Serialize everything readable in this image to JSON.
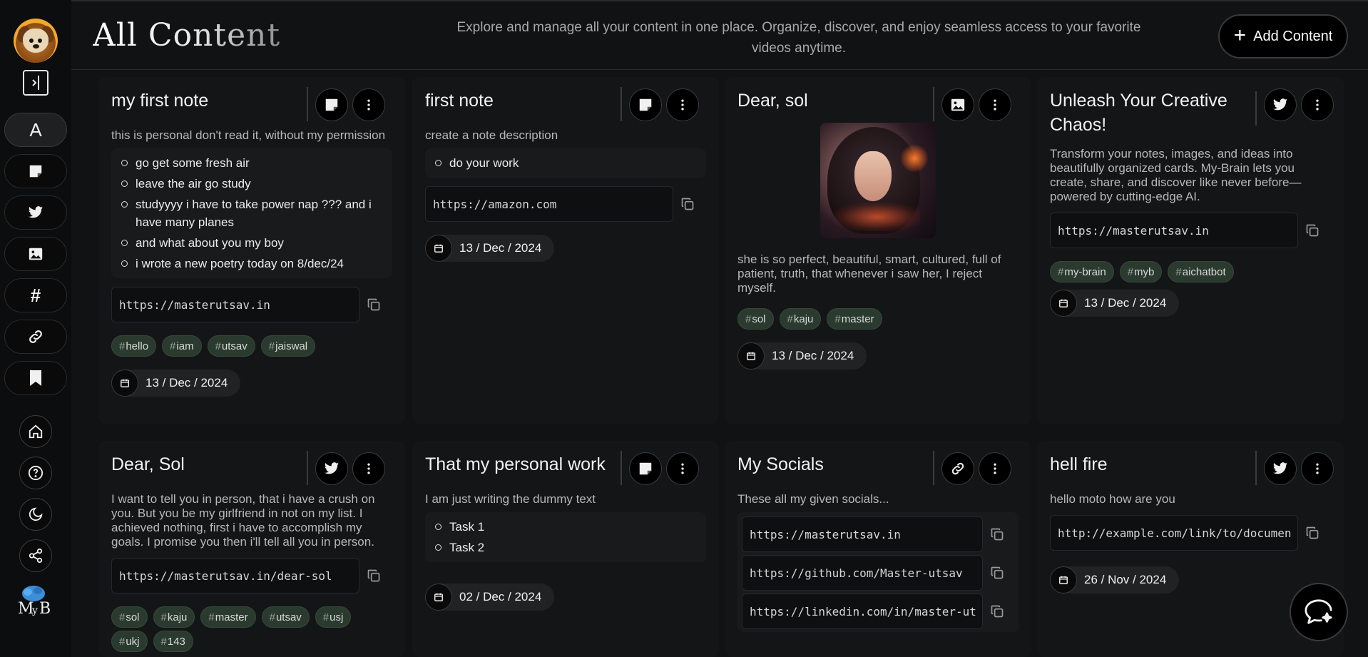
{
  "header": {
    "title": "All Content",
    "subtitle": "Explore and manage all your content in one place. Organize, discover, and enjoy seamless access to your favorite videos anytime.",
    "add_button": "Add Content"
  },
  "sidebar": {
    "nav_items": [
      {
        "name": "all",
        "label": "A"
      },
      {
        "name": "notes",
        "icon": "note-icon"
      },
      {
        "name": "tweets",
        "icon": "twitter-icon"
      },
      {
        "name": "images",
        "icon": "image-icon"
      },
      {
        "name": "tags",
        "label": "#"
      },
      {
        "name": "links",
        "icon": "link-icon"
      },
      {
        "name": "bookmarks",
        "icon": "bookmark-icon"
      }
    ],
    "round_items": [
      "home-icon",
      "help-icon",
      "moon-icon",
      "share-icon"
    ],
    "brand": "MyB"
  },
  "cards": [
    {
      "title": "my first note",
      "type_icon": "note-icon",
      "description": "this is personal don't read it, without my permission",
      "tasks": [
        "go get some fresh air",
        "leave the air go study",
        "studyyyy i have to take power nap ??? and i have many planes",
        "and what about you my boy",
        "i wrote a new poetry today on 8/dec/24"
      ],
      "links": [
        "https://masterutsav.in"
      ],
      "tags": [
        "hello",
        "iam",
        "utsav",
        "jaiswal"
      ],
      "date": "13 / Dec / 2024"
    },
    {
      "title": "first note",
      "type_icon": "note-icon",
      "description": "create a note description",
      "tasks": [
        "do your work"
      ],
      "links": [
        "https://amazon.com"
      ],
      "tags": [],
      "date": "13 / Dec / 2024"
    },
    {
      "title": "Dear, sol",
      "type_icon": "image-icon",
      "description": "she is so perfect, beautiful, smart, cultured, full of patient, truth, that whenever i saw her, I reject myself.",
      "tags": [
        "sol",
        "kaju",
        "master"
      ],
      "date": "13 / Dec / 2024"
    },
    {
      "title": "Unleash Your Creative Chaos!",
      "type_icon": "twitter-icon",
      "description": "Transform your notes, images, and ideas into beautifully organized cards. My-Brain lets you create, share, and discover like never before—powered by cutting-edge AI.",
      "links": [
        "https://masterutsav.in"
      ],
      "tags": [
        "my-brain",
        "myb",
        "aichatbot"
      ],
      "date": "13 / Dec / 2024"
    },
    {
      "title": "Dear, Sol",
      "type_icon": "twitter-icon",
      "description": "I want to tell you in person, that i have a crush on you. But you be my girlfriend in not on my list. I achieved nothing, first i have to accomplish my goals. I promise you then i'll tell all you in person.",
      "links": [
        "https://masterutsav.in/dear-sol"
      ],
      "tags": [
        "sol",
        "kaju",
        "master",
        "utsav",
        "usj",
        "ukj",
        "143"
      ]
    },
    {
      "title": "That my personal work",
      "type_icon": "note-icon",
      "description": "I am just writing the dummy text",
      "tasks": [
        "Task 1",
        "Task 2"
      ],
      "date": "02 / Dec / 2024"
    },
    {
      "title": "My Socials",
      "type_icon": "link-icon",
      "description": "These all my given socials...",
      "links": [
        "https://masterutsav.in",
        "https://github.com/Master-utsav",
        "https://linkedin.com/in/master-ut"
      ]
    },
    {
      "title": "hell fire",
      "type_icon": "twitter-icon",
      "description": "hello moto how are you",
      "links": [
        "http://example.com/link/to/documen"
      ],
      "date": "26 / Nov / 2024"
    }
  ],
  "colors": {
    "background": "#111214",
    "card": "#141517",
    "tag_bg": "#2a3a2f"
  }
}
